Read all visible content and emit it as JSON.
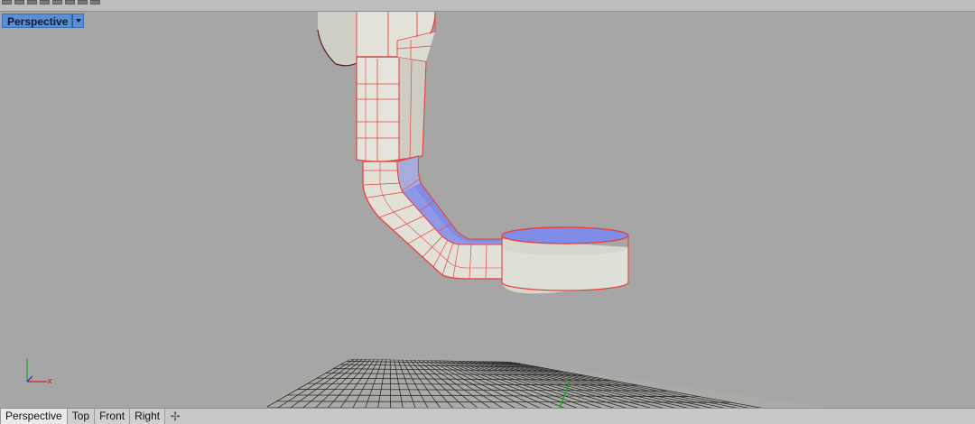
{
  "viewport": {
    "label": "Perspective"
  },
  "tabs": [
    {
      "label": "Perspective",
      "active": true
    },
    {
      "label": "Top",
      "active": false
    },
    {
      "label": "Front",
      "active": false
    },
    {
      "label": "Right",
      "active": false
    }
  ],
  "add_tab_icon": "plus-icon",
  "colors": {
    "viewport_bg": "#a6a6a6",
    "label_bg": "#5a8fd6",
    "edge": "#e8413c",
    "surface": "#d9d9d0",
    "cap": "#7f8ce8",
    "grid": "#1f1f1f",
    "grid_accent": "#1aa01a",
    "axis_x": "#c22222",
    "axis_y": "#22a022"
  }
}
